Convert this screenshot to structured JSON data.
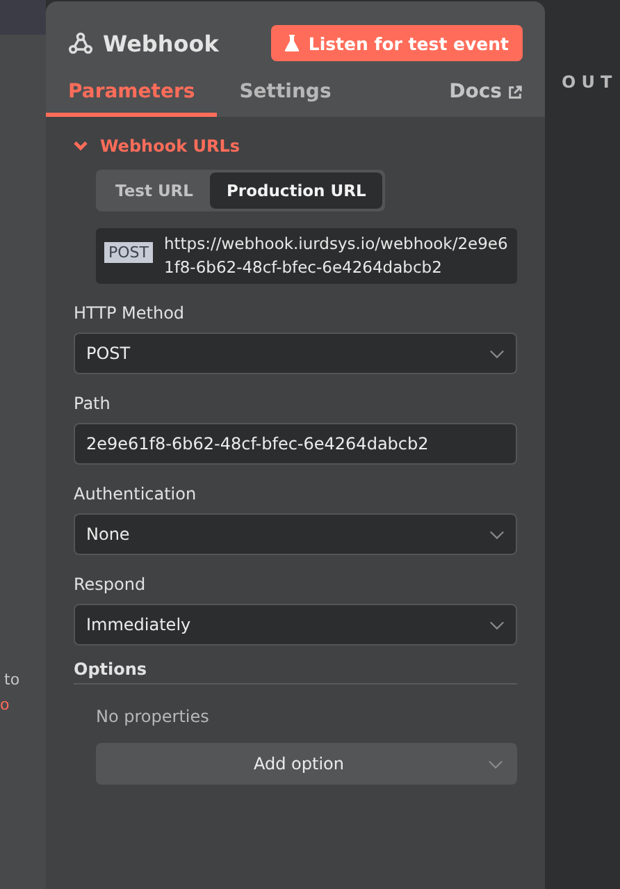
{
  "left_strip": {
    "texts": [
      {
        "text": "to",
        "kind": "plain"
      },
      {
        "text": "o",
        "kind": "error"
      }
    ]
  },
  "right_panel": {
    "heading": "OUT"
  },
  "node": {
    "title": "Webhook",
    "listen_button": "Listen for test event"
  },
  "tabs": [
    {
      "label": "Parameters",
      "selected": true
    },
    {
      "label": "Settings",
      "selected": false
    }
  ],
  "docs_link": "Docs",
  "webhook_urls": {
    "title": "Webhook URLs",
    "expanded": true,
    "url_tabs": [
      {
        "label": "Test URL",
        "selected": false
      },
      {
        "label": "Production URL",
        "selected": true
      }
    ],
    "method_badge": "POST",
    "url": "https://webhook.iurdsys.io/webhook/2e9e61f8-6b62-48cf-bfec-6e4264dabcb2"
  },
  "fields": [
    {
      "label": "HTTP Method",
      "kind": "select",
      "value": "POST"
    },
    {
      "label": "Path",
      "kind": "text",
      "value": "2e9e61f8-6b62-48cf-bfec-6e4264dabcb2"
    },
    {
      "label": "Authentication",
      "kind": "select",
      "value": "None"
    },
    {
      "label": "Respond",
      "kind": "select",
      "value": "Immediately"
    }
  ],
  "options": {
    "title": "Options",
    "empty_text": "No properties",
    "add_button": "Add option"
  }
}
